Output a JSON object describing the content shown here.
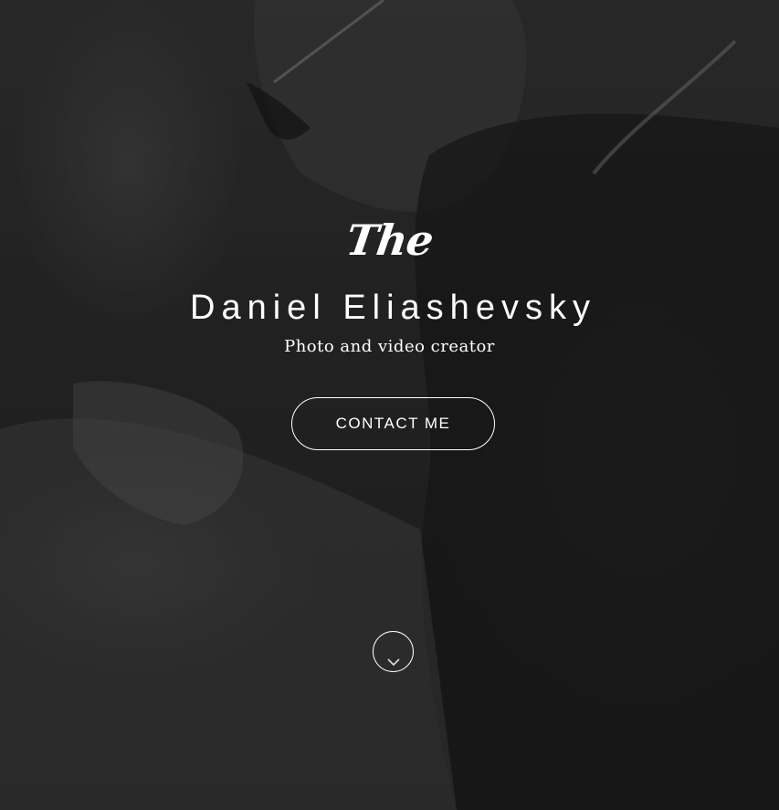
{
  "hero": {
    "script_word": "The",
    "name": "Daniel Eliashevsky",
    "tagline": "Photo and video creator",
    "contact_button_label": "CONTACT ME",
    "scroll_icon": "chevron-down-icon",
    "background_image": "grayscale photo of a man wearing sunglasses and a t-shirt reading a map outdoors"
  },
  "colors": {
    "text": "#ffffff",
    "overlay": "#000000"
  }
}
